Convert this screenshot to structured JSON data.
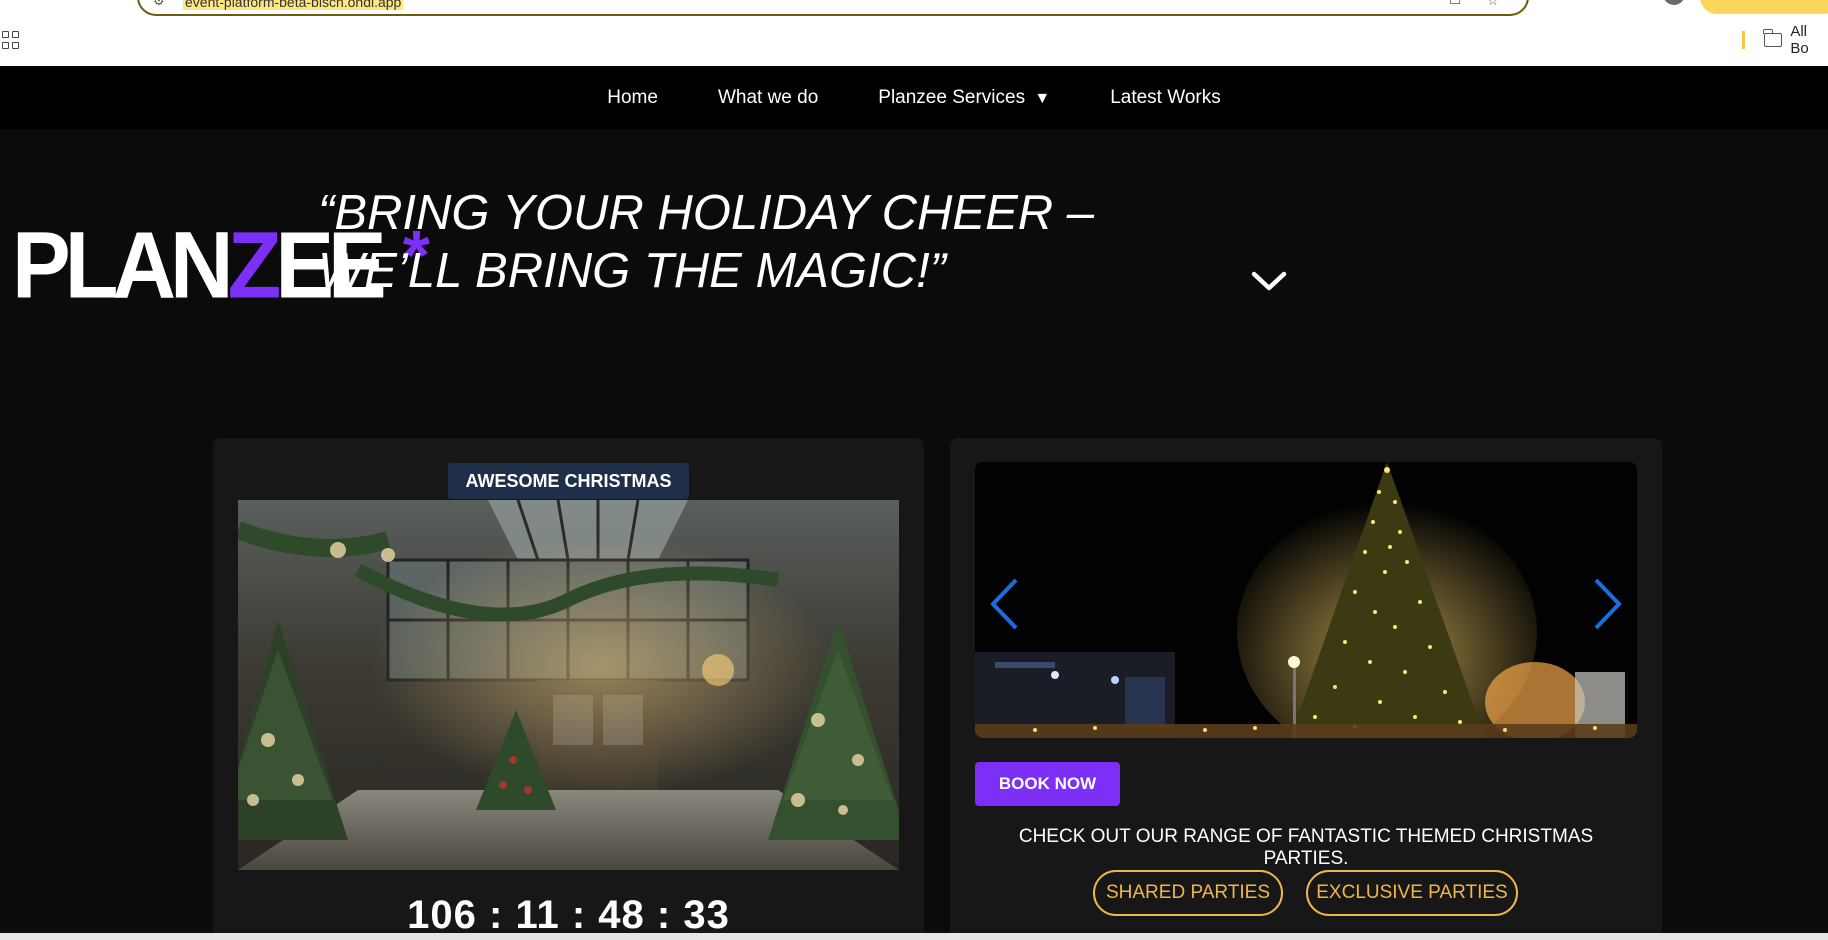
{
  "browser": {
    "url": "event-platform-beta-bisch.ondi.app",
    "bookmarks_folder_label": "All Bo"
  },
  "nav": {
    "items": [
      {
        "label": "Home"
      },
      {
        "label": "What we do"
      },
      {
        "label": "Planzee Services",
        "caret": "▼"
      },
      {
        "label": "Latest Works"
      }
    ]
  },
  "hero": {
    "logo": {
      "part1": "PLAN",
      "z": "Z",
      "part2": "EE",
      "asterisk": "*"
    },
    "tagline_line1": "“BRING YOUR HOLIDAY CHEER –",
    "tagline_line2": "WE’LL BRING THE MAGIC!”"
  },
  "event_card": {
    "badge": "AWESOME CHRISTMAS",
    "countdown": "106 : 11 : 48 : 33"
  },
  "promo_card": {
    "book_now_label": "BOOK NOW",
    "promo_text": "CHECK OUT OUR RANGE OF FANTASTIC THEMED CHRISTMAS PARTIES.",
    "shared_label": "SHARED PARTIES",
    "exclusive_label": "EXCLUSIVE PARTIES"
  },
  "colors": {
    "accent_purple": "#7b2ff7",
    "gold": "#f0b745",
    "badge_bg": "#1f2f4a",
    "arrow_blue": "#1a6fe0"
  }
}
